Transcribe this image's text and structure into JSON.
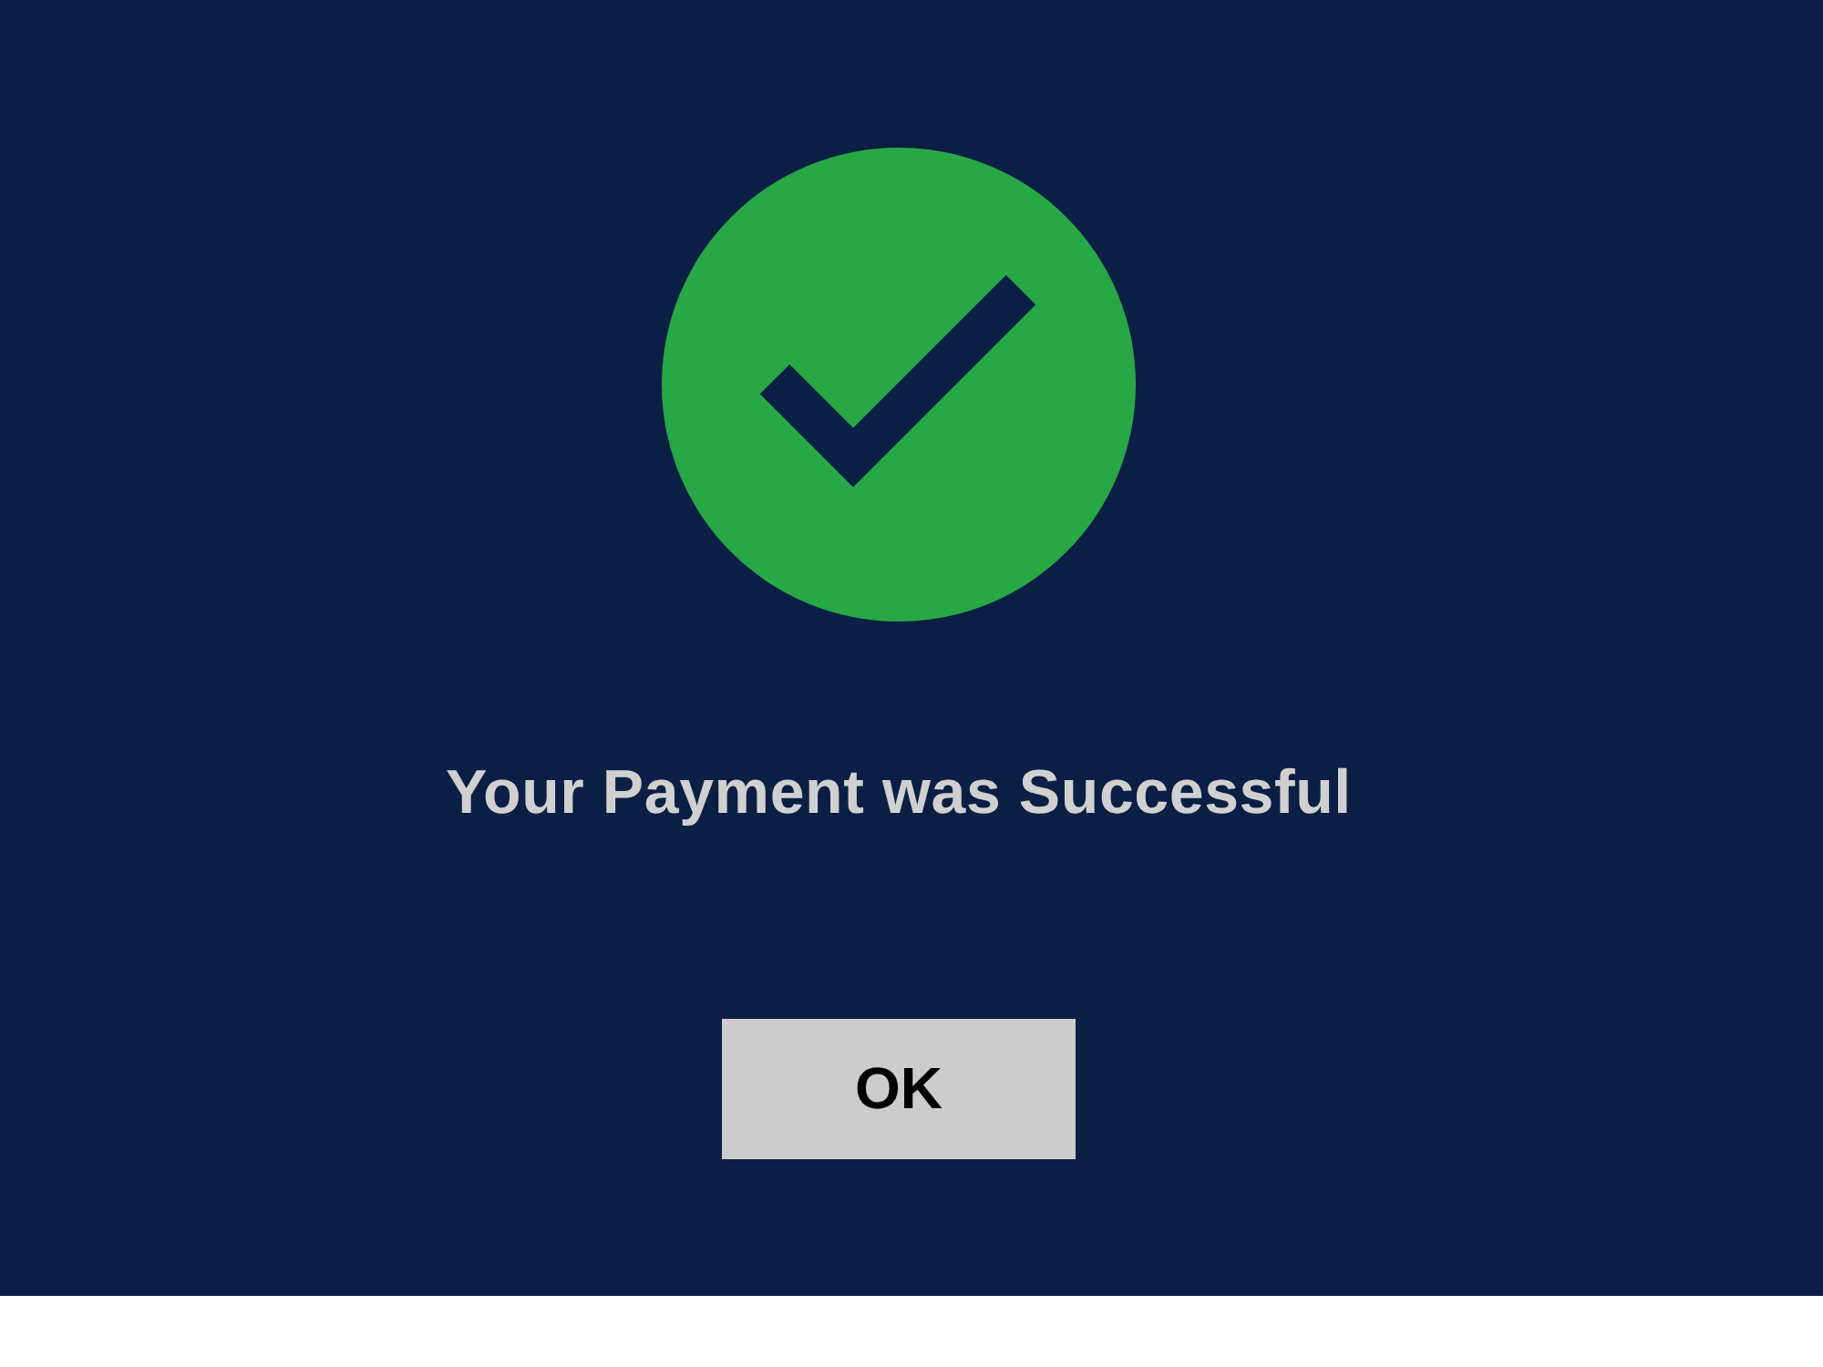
{
  "message": "Your Payment was Successful",
  "buttons": [
    {
      "label": "OK"
    }
  ]
}
